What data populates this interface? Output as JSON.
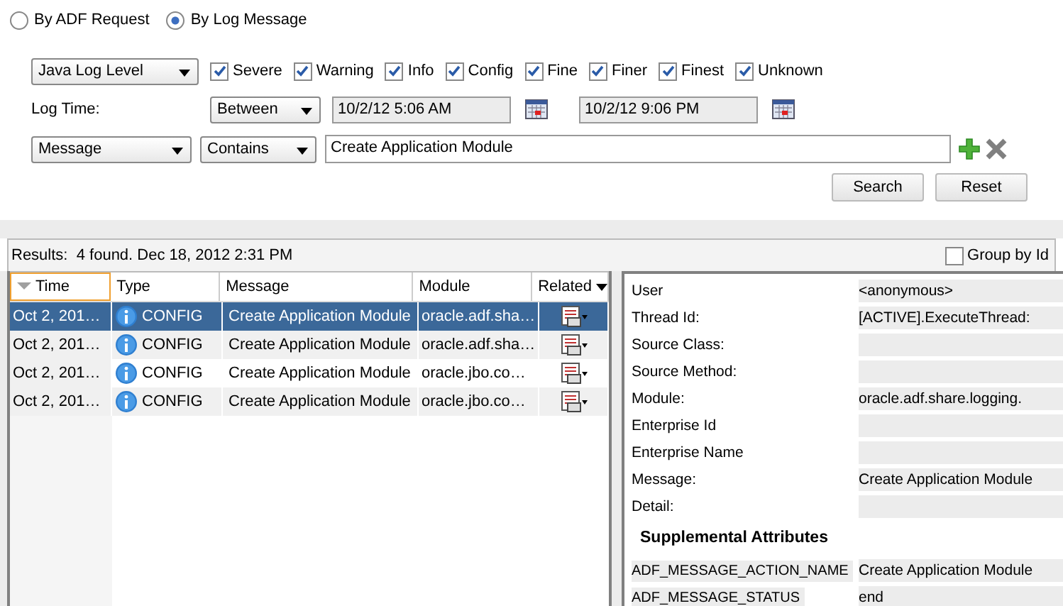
{
  "mode_options": [
    {
      "label": "By ADF Request",
      "selected": false
    },
    {
      "label": "By Log Message",
      "selected": true
    }
  ],
  "level_filter": {
    "dropdown": "Java Log Level",
    "levels": [
      {
        "label": "Severe",
        "checked": true
      },
      {
        "label": "Warning",
        "checked": true
      },
      {
        "label": "Info",
        "checked": true
      },
      {
        "label": "Config",
        "checked": true
      },
      {
        "label": "Fine",
        "checked": true
      },
      {
        "label": "Finer",
        "checked": true
      },
      {
        "label": "Finest",
        "checked": true
      },
      {
        "label": "Unknown",
        "checked": true
      }
    ]
  },
  "log_time": {
    "label": "Log Time:",
    "operator": "Between",
    "from": "10/2/12 5:06 AM",
    "to": "10/2/12 9:06 PM"
  },
  "message_filter": {
    "field": "Message",
    "operator": "Contains",
    "value": "Create Application Module"
  },
  "buttons": [
    "Search",
    "Reset"
  ],
  "results": {
    "summary": "Results:  4 found. Dec 18, 2012 2:31 PM",
    "group_by": {
      "label": "Group by Id",
      "checked": false
    }
  },
  "table": {
    "columns": [
      {
        "label": "Time",
        "sorted": true
      },
      {
        "label": "Type",
        "sorted": false
      },
      {
        "label": "Message",
        "sorted": false
      },
      {
        "label": "Module",
        "sorted": false
      },
      {
        "label": "Related",
        "sorted": false
      }
    ],
    "rows": [
      {
        "time": "Oct 2, 201…",
        "type": "CONFIG",
        "message": "Create Application Module",
        "module": "oracle.adf.sha…",
        "selected": true
      },
      {
        "time": "Oct 2, 201…",
        "type": "CONFIG",
        "message": "Create Application Module",
        "module": "oracle.adf.sha…",
        "selected": false
      },
      {
        "time": "Oct 2, 201…",
        "type": "CONFIG",
        "message": "Create Application Module",
        "module": "oracle.jbo.co…",
        "selected": false
      },
      {
        "time": "Oct 2, 201…",
        "type": "CONFIG",
        "message": "Create Application Module",
        "module": "oracle.jbo.co…",
        "selected": false
      }
    ]
  },
  "details": {
    "fields": [
      {
        "label": "User",
        "value": "<anonymous>"
      },
      {
        "label": "Thread Id:",
        "value": "[ACTIVE].ExecuteThread:"
      },
      {
        "label": "Source Class:"
      },
      {
        "label": "Source Method:"
      },
      {
        "label": "Module:",
        "value": "oracle.adf.share.logging."
      },
      {
        "label": "Enterprise Id"
      },
      {
        "label": "Enterprise Name"
      },
      {
        "label": "Message:",
        "value": "Create Application Module"
      },
      {
        "label": "Detail:"
      }
    ],
    "section_title": "Supplemental Attributes",
    "supplemental": [
      {
        "label": "ADF_MESSAGE_ACTION_NAME",
        "value": "Create Application Module"
      },
      {
        "label": "ADF_MESSAGE_STATUS",
        "value": "end"
      }
    ]
  }
}
